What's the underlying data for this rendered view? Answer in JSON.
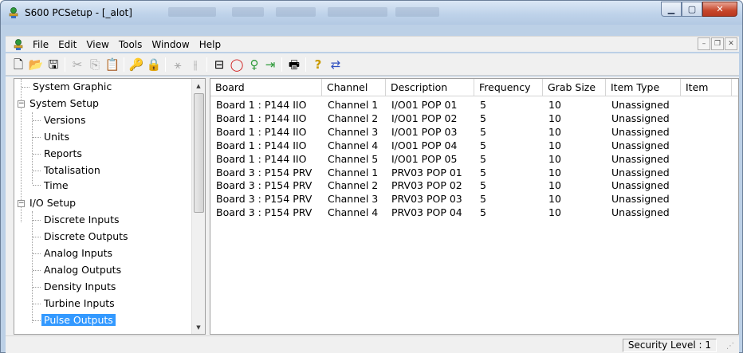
{
  "window": {
    "title": "S600 PCSetup - [_alot]",
    "accent": "#3399ff"
  },
  "menu": {
    "items": [
      "File",
      "Edit",
      "View",
      "Tools",
      "Window",
      "Help"
    ]
  },
  "toolbar": {
    "icons": [
      "new-file-icon",
      "open-folder-icon",
      "save-icon",
      "cut-icon",
      "copy-icon",
      "paste-icon",
      "key-icon",
      "lock-icon",
      "connect-icon",
      "disconnect-icon",
      "minus-box-icon",
      "stop-icon",
      "pin-icon",
      "export-icon",
      "print-icon",
      "help-icon",
      "arrows-icon"
    ]
  },
  "tree": {
    "items": [
      {
        "label": "System Graphic",
        "level": 1
      },
      {
        "label": "System Setup",
        "level": 0,
        "expanded": true
      },
      {
        "label": "Versions",
        "level": 1
      },
      {
        "label": "Units",
        "level": 1
      },
      {
        "label": "Reports",
        "level": 1
      },
      {
        "label": "Totalisation",
        "level": 1
      },
      {
        "label": "Time",
        "level": 1
      },
      {
        "label": "I/O Setup",
        "level": 0,
        "expanded": true
      },
      {
        "label": "Discrete Inputs",
        "level": 1
      },
      {
        "label": "Discrete Outputs",
        "level": 1
      },
      {
        "label": "Analog Inputs",
        "level": 1
      },
      {
        "label": "Analog Outputs",
        "level": 1
      },
      {
        "label": "Density Inputs",
        "level": 1
      },
      {
        "label": "Turbine Inputs",
        "level": 1
      },
      {
        "label": "Pulse Outputs",
        "level": 1,
        "selected": true
      }
    ]
  },
  "table": {
    "columns": [
      "Board",
      "Channel",
      "Description",
      "Frequency",
      "Grab Size",
      "Item Type",
      "Item"
    ],
    "rows": [
      [
        "Board 1 : P144 IIO",
        "Channel 1",
        "I/O01 POP 01",
        "5",
        "10",
        "Unassigned",
        ""
      ],
      [
        "Board 1 : P144 IIO",
        "Channel 2",
        "I/O01 POP 02",
        "5",
        "10",
        "Unassigned",
        ""
      ],
      [
        "Board 1 : P144 IIO",
        "Channel 3",
        "I/O01 POP 03",
        "5",
        "10",
        "Unassigned",
        ""
      ],
      [
        "Board 1 : P144 IIO",
        "Channel 4",
        "I/O01 POP 04",
        "5",
        "10",
        "Unassigned",
        ""
      ],
      [
        "Board 1 : P144 IIO",
        "Channel 5",
        "I/O01 POP 05",
        "5",
        "10",
        "Unassigned",
        ""
      ],
      [
        "Board 3 : P154 PRV",
        "Channel 1",
        "PRV03 POP 01",
        "5",
        "10",
        "Unassigned",
        ""
      ],
      [
        "Board 3 : P154 PRV",
        "Channel 2",
        "PRV03 POP 02",
        "5",
        "10",
        "Unassigned",
        ""
      ],
      [
        "Board 3 : P154 PRV",
        "Channel 3",
        "PRV03 POP 03",
        "5",
        "10",
        "Unassigned",
        ""
      ],
      [
        "Board 3 : P154 PRV",
        "Channel 4",
        "PRV03 POP 04",
        "5",
        "10",
        "Unassigned",
        ""
      ]
    ]
  },
  "status": {
    "security": "Security Level : 1"
  }
}
